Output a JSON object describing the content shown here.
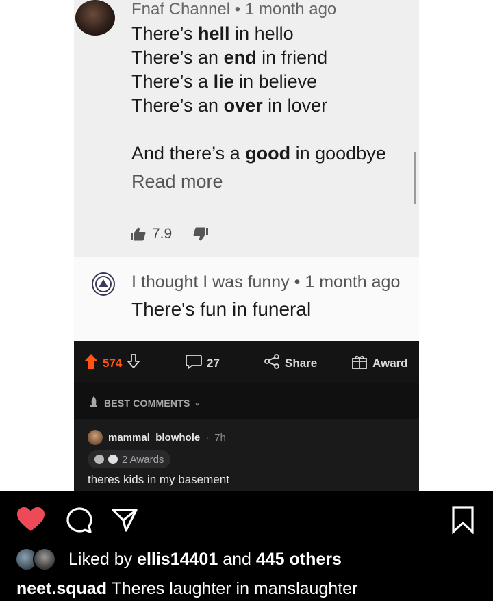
{
  "youtube": {
    "comment1": {
      "author": "Fnaf Channel",
      "time": "1 month ago",
      "lines": [
        {
          "pre": "There’s ",
          "bold": "hell",
          "post": " in hello"
        },
        {
          "pre": "There’s an ",
          "bold": "end",
          "post": " in friend"
        },
        {
          "pre": "There’s a ",
          "bold": "lie",
          "post": " in believe"
        },
        {
          "pre": "There’s an ",
          "bold": "over",
          "post": " in lover"
        },
        {
          "pre": "And there’s a ",
          "bold": "good",
          "post": " in goodbye"
        }
      ],
      "read_more": "Read more",
      "likes": "7.9"
    },
    "comment2": {
      "author": "I thought I was funny",
      "time": "1 month ago",
      "text": "There's fun in funeral"
    }
  },
  "reddit": {
    "upvotes": "574",
    "comments": "27",
    "share_label": "Share",
    "award_label": "Award",
    "sort_label": "BEST COMMENTS",
    "comment": {
      "username": "mammal_blowhole",
      "time": "7h",
      "awards": "2 Awards",
      "text": "theres kids in my basement"
    },
    "colors": {
      "upvote": "#ff5414",
      "background": "#1a1a1b"
    }
  },
  "instagram": {
    "liked_prefix": "Liked by",
    "liked_user": "ellis14401",
    "liked_and": "and",
    "liked_others": "445 others",
    "caption_user": "neet.squad",
    "caption_text": "Theres laughter in manslaughter",
    "colors": {
      "heart": "#ed4956"
    }
  }
}
